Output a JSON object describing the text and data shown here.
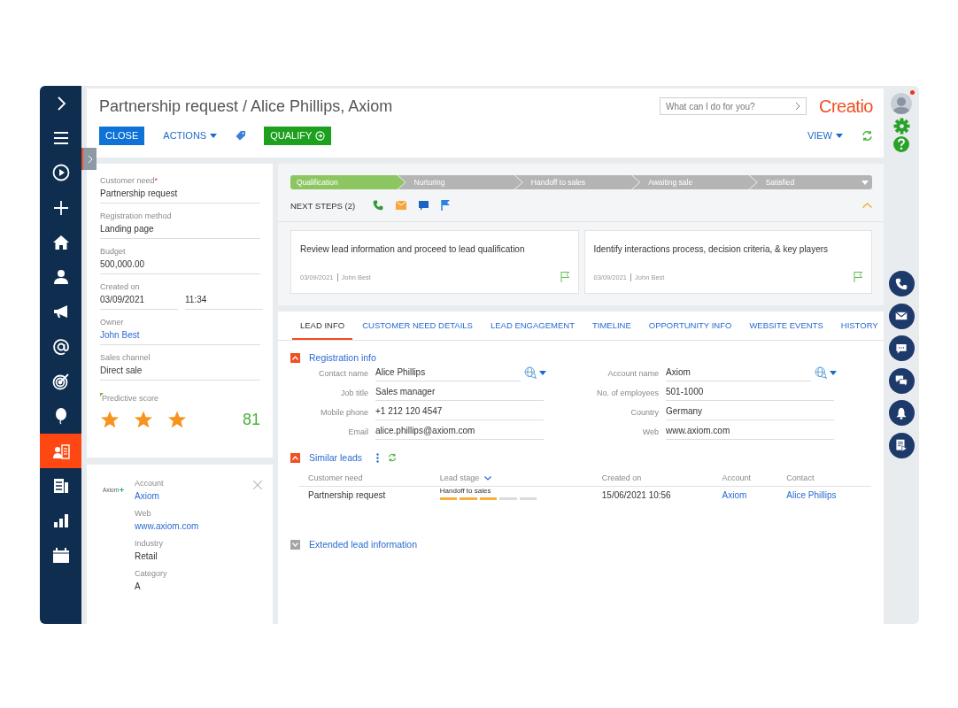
{
  "nav": [
    {
      "kind": "expand",
      "selected": false
    },
    {
      "kind": "menu",
      "selected": false
    },
    {
      "kind": "play",
      "selected": false
    },
    {
      "kind": "plus",
      "selected": false
    },
    {
      "kind": "home",
      "selected": false
    },
    {
      "kind": "person",
      "selected": false
    },
    {
      "kind": "megaphone",
      "selected": false
    },
    {
      "kind": "at",
      "selected": false
    },
    {
      "kind": "target",
      "selected": false
    },
    {
      "kind": "balloon",
      "selected": false
    },
    {
      "kind": "leads",
      "selected": true
    },
    {
      "kind": "building",
      "selected": false
    },
    {
      "kind": "chart",
      "selected": false
    },
    {
      "kind": "calendar",
      "selected": false
    }
  ],
  "title": "Partnership request / Alice Phillips, Axiom",
  "toolbar": {
    "close": "CLOSE",
    "actions": "ACTIONS",
    "qualify": "QUALIFY",
    "view": "VIEW"
  },
  "search": {
    "placeholder": "What can I do for you?"
  },
  "logo": "Creatio",
  "required_symbol": "*",
  "profile": {
    "fields": [
      {
        "label": "Customer need",
        "required": true,
        "kind": "text",
        "values": [
          "Partnership request"
        ]
      },
      {
        "label": "Registration method",
        "required": false,
        "kind": "text",
        "values": [
          "Landing page"
        ]
      },
      {
        "label": "Budget",
        "required": false,
        "kind": "text",
        "values": [
          "500,000.00"
        ]
      },
      {
        "label": "Created on",
        "required": false,
        "kind": "datetime",
        "values": [
          "03/09/2021",
          "11:34"
        ]
      },
      {
        "label": "Owner",
        "required": false,
        "kind": "link",
        "values": [
          "John Best"
        ]
      },
      {
        "label": "Sales channel",
        "required": false,
        "kind": "text",
        "values": [
          "Direct sale"
        ]
      }
    ],
    "predictive_score": {
      "label": "Predictive score",
      "stars": 3,
      "score": "81"
    }
  },
  "account_card": {
    "logo": "Axiom",
    "fields": [
      {
        "label": "Account",
        "kind": "link",
        "value": "Axiom"
      },
      {
        "label": "Web",
        "kind": "link",
        "value": "www.axiom.com"
      },
      {
        "label": "Industry",
        "kind": "text",
        "value": "Retail"
      },
      {
        "label": "Category",
        "kind": "text",
        "value": "A"
      }
    ]
  },
  "stages": [
    {
      "label": "Qualification",
      "selected": true
    },
    {
      "label": "Nurturing",
      "selected": false
    },
    {
      "label": "Handoff to sales",
      "selected": false
    },
    {
      "label": "Awaiting sale",
      "selected": false
    },
    {
      "label": "Satisfied",
      "selected": false
    }
  ],
  "next_steps": {
    "title": "NEXT STEPS (2)",
    "items": [
      {
        "text": "Review lead information and proceed to lead qualification",
        "date": "03/09/2021",
        "owner": "John Best"
      },
      {
        "text": "Identify interactions process, decision criteria, & key players",
        "date": "03/09/2021",
        "owner": "John Best"
      }
    ]
  },
  "tabs": [
    {
      "label": "LEAD INFO",
      "selected": true
    },
    {
      "label": "CUSTOMER NEED DETAILS",
      "selected": false
    },
    {
      "label": "LEAD ENGAGEMENT",
      "selected": false
    },
    {
      "label": "TIMELINE",
      "selected": false
    },
    {
      "label": "OPPORTUNITY INFO",
      "selected": false
    },
    {
      "label": "WEBSITE EVENTS",
      "selected": false
    },
    {
      "label": "HISTORY",
      "selected": false
    }
  ],
  "registration_info": {
    "title": "Registration info",
    "expanded": true,
    "columns": [
      [
        {
          "label": "Contact name",
          "value": "Alice Phillips",
          "lookup": true
        },
        {
          "label": "Job title",
          "value": "Sales manager",
          "lookup": false
        },
        {
          "label": "Mobile phone",
          "value": "+1 212 120 4547",
          "lookup": false
        },
        {
          "label": "Email",
          "value": "alice.phillips@axiom.com",
          "lookup": false
        }
      ],
      [
        {
          "label": "Account name",
          "value": "Axiom",
          "lookup": true
        },
        {
          "label": "No. of employees",
          "value": "501-1000",
          "lookup": false
        },
        {
          "label": "Country",
          "value": "Germany",
          "lookup": false
        },
        {
          "label": "Web",
          "value": "www.axiom.com",
          "lookup": false
        }
      ]
    ]
  },
  "similar_leads": {
    "title": "Similar leads",
    "expanded": true,
    "columns": [
      "Customer need",
      "Lead stage",
      "Created on",
      "Account",
      "Contact"
    ],
    "rows": [
      {
        "customer_need": "Partnership request",
        "lead_stage": "Handoff to sales",
        "level": 0.6,
        "created_on": "15/06/2021 10:56",
        "account": "Axiom",
        "contact": "Alice Phillips"
      }
    ]
  },
  "extended_info": {
    "title": "Extended lead information",
    "expanded": false
  },
  "rail": {
    "top": [
      {
        "kind": "avatar",
        "notification": true
      },
      {
        "kind": "gear"
      },
      {
        "kind": "help"
      }
    ],
    "bottom": [
      {
        "kind": "phone"
      },
      {
        "kind": "mail"
      },
      {
        "kind": "chat"
      },
      {
        "kind": "chats"
      },
      {
        "kind": "bell"
      },
      {
        "kind": "document"
      }
    ]
  }
}
